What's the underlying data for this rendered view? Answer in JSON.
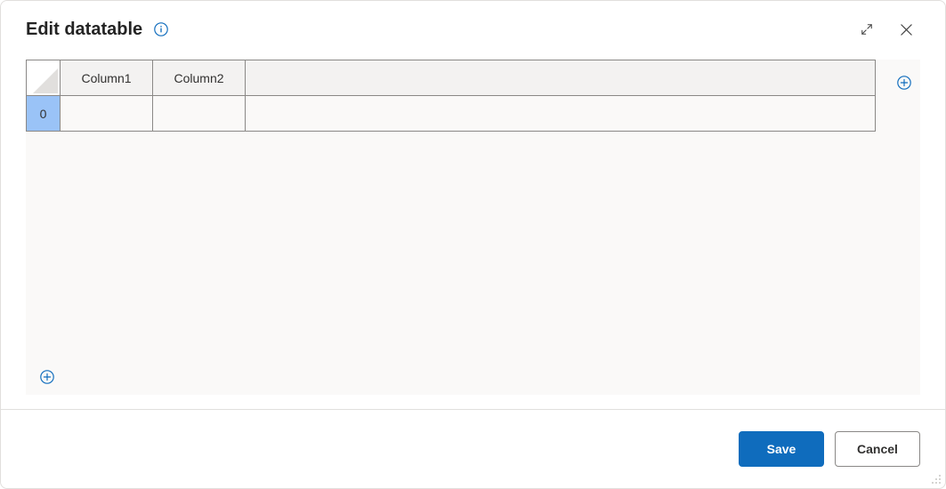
{
  "dialog": {
    "title": "Edit datatable"
  },
  "table": {
    "columns": [
      "Column1",
      "Column2",
      ""
    ],
    "rows": [
      {
        "index": "0",
        "cells": [
          "",
          "",
          ""
        ]
      }
    ]
  },
  "footer": {
    "save_label": "Save",
    "cancel_label": "Cancel"
  }
}
